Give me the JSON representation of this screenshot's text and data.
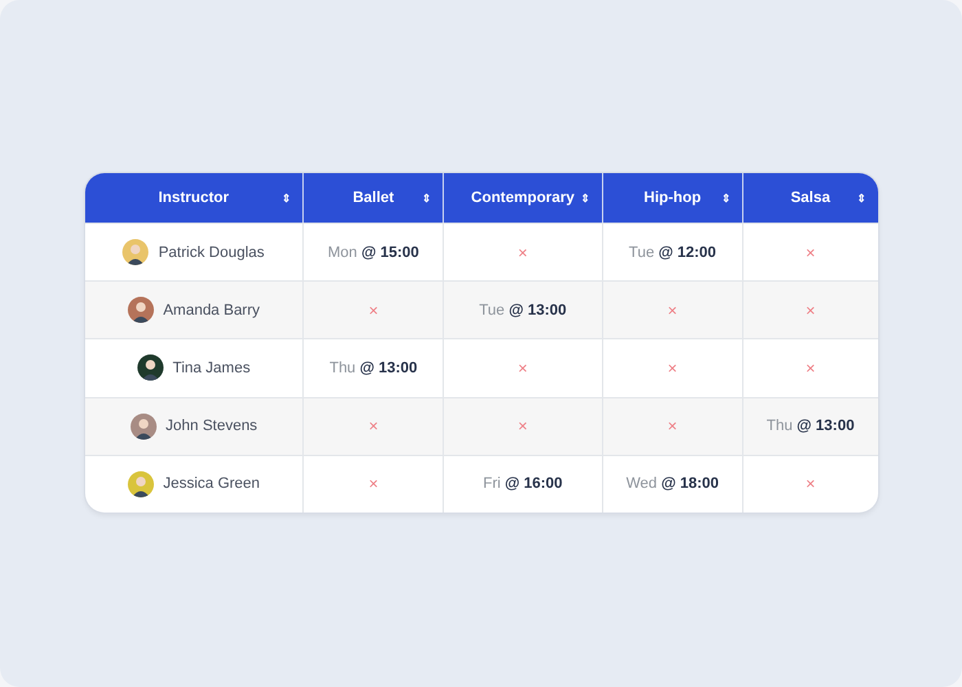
{
  "table": {
    "columns": [
      {
        "label": "Instructor",
        "sort": "⇕"
      },
      {
        "label": "Ballet",
        "sort": "⇕"
      },
      {
        "label": "Contemporary",
        "sort": "⇕"
      },
      {
        "label": "Hip-hop",
        "sort": "⇕"
      },
      {
        "label": "Salsa",
        "sort": "⇕"
      }
    ],
    "rows": [
      {
        "cells": [
          {
            "kind": "instructor",
            "text": "Patrick Douglas",
            "color": "#e9c46a"
          },
          {
            "kind": "slot",
            "text": "Mon **@ 15:00**"
          },
          {
            "kind": "none",
            "text": "×"
          },
          {
            "kind": "slot",
            "text": "Tue **@ 12:00**"
          },
          {
            "kind": "none",
            "text": "×"
          }
        ]
      },
      {
        "cells": [
          {
            "kind": "instructor",
            "text": "Amanda Barry",
            "color": "#b5735a"
          },
          {
            "kind": "none",
            "text": "×"
          },
          {
            "kind": "slot",
            "text": "Tue **@ 13:00**"
          },
          {
            "kind": "none",
            "text": "×"
          },
          {
            "kind": "none",
            "text": "×"
          }
        ]
      },
      {
        "cells": [
          {
            "kind": "instructor",
            "text": "Tina James",
            "color": "#1f3a2c"
          },
          {
            "kind": "slot",
            "text": "Thu **@ 13:00**"
          },
          {
            "kind": "none",
            "text": "×"
          },
          {
            "kind": "none",
            "text": "×"
          },
          {
            "kind": "none",
            "text": "×"
          }
        ]
      },
      {
        "cells": [
          {
            "kind": "instructor",
            "text": "John Stevens",
            "color": "#a88c84"
          },
          {
            "kind": "none",
            "text": "×"
          },
          {
            "kind": "none",
            "text": "×"
          },
          {
            "kind": "none",
            "text": "×"
          },
          {
            "kind": "slot",
            "text": "Thu **@ 13:00**"
          }
        ]
      },
      {
        "cells": [
          {
            "kind": "instructor",
            "text": "Jessica Green",
            "color": "#d9c43c"
          },
          {
            "kind": "none",
            "text": "×"
          },
          {
            "kind": "slot",
            "text": "Fri **@ 16:00**"
          },
          {
            "kind": "slot",
            "text": "Wed **@ 18:00**"
          },
          {
            "kind": "none",
            "text": "×"
          }
        ]
      }
    ]
  }
}
